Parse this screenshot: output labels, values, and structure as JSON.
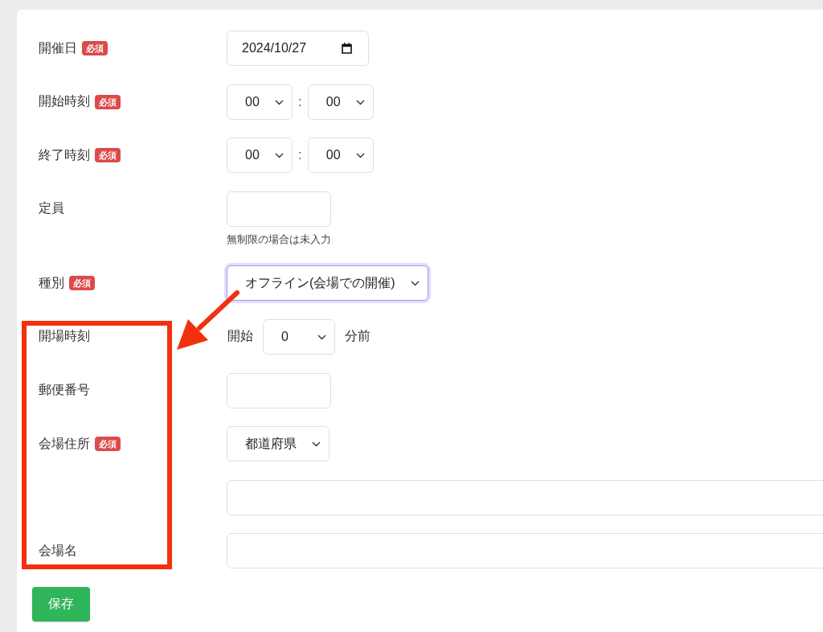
{
  "form": {
    "fields": [
      {
        "kind": "date",
        "label": "開催日",
        "badge": "必須",
        "value": "2024/10/27"
      },
      {
        "kind": "time",
        "label": "開始時刻",
        "badge": "必須",
        "hour": "00",
        "separator": ":",
        "minute": "00"
      },
      {
        "kind": "time",
        "label": "終了時刻",
        "badge": "必須",
        "hour": "00",
        "separator": ":",
        "minute": "00"
      },
      {
        "kind": "number",
        "label": "定員",
        "help": "無制限の場合は未入力"
      },
      {
        "kind": "choice",
        "label": "種別",
        "badge": "必須",
        "value": "オフライン(会場での開催)",
        "focused": true
      },
      {
        "kind": "offset",
        "label": "開場時刻",
        "prefix": "開始",
        "value": "0",
        "suffix": "分前"
      },
      {
        "kind": "postcode",
        "label": "郵便番号"
      },
      {
        "kind": "choice",
        "label": "会場住所",
        "badge": "必須",
        "value": "都道府県",
        "focused": false
      },
      {
        "kind": "address_line"
      },
      {
        "kind": "text",
        "label": "会場名"
      }
    ]
  },
  "save_button": "保存",
  "annotation": {
    "frame": true,
    "arrow": true
  }
}
